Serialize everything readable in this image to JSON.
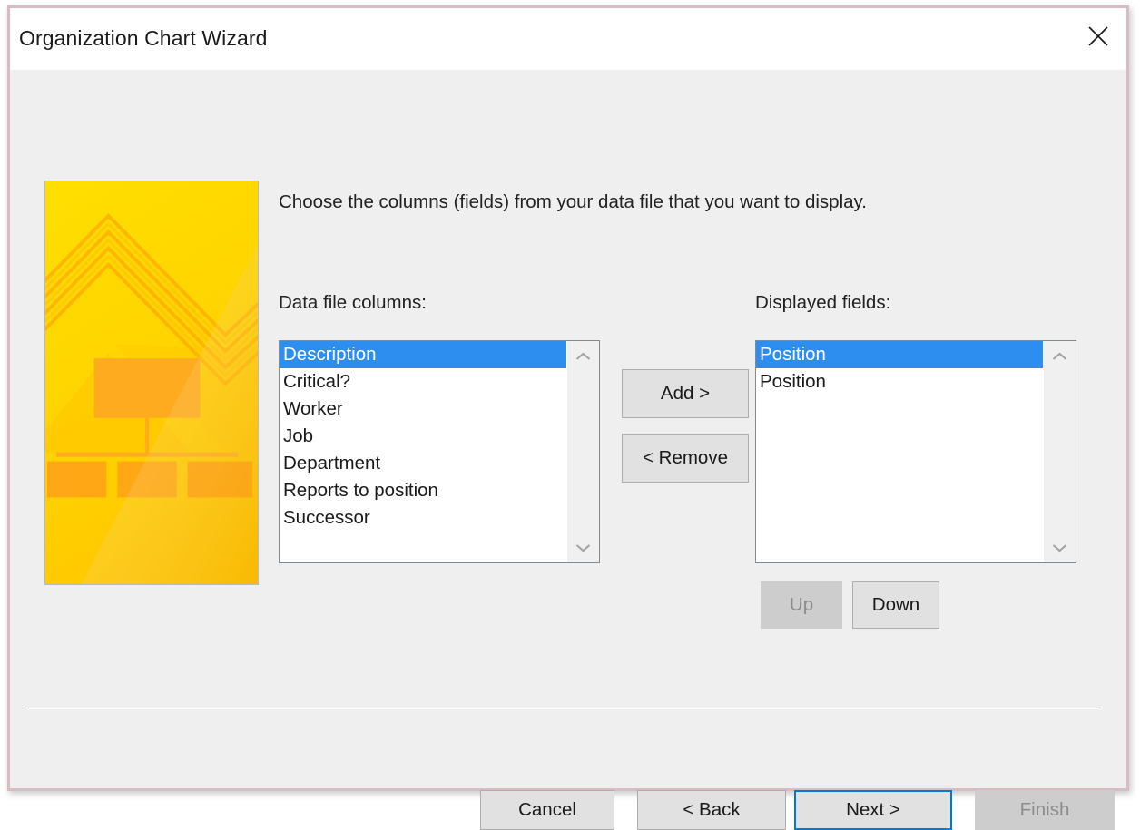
{
  "window": {
    "title": "Organization Chart Wizard",
    "close_icon": "close-icon",
    "border_color": "#d7bcc1",
    "titlebar_bg": "#ffffff",
    "body_bg": "#efefef"
  },
  "banner": {
    "alt": "organization-chart-wizard-banner",
    "base_color": "#ffdc00",
    "accent_color": "#ffb400",
    "shade_color": "#fcc200"
  },
  "main": {
    "instruction": "Choose the columns (fields) from your data file that you want to display."
  },
  "left_panel": {
    "label": "Data file columns:",
    "selection_color": "#2e8ef0",
    "items": [
      {
        "label": "Description",
        "selected": true
      },
      {
        "label": "Critical?",
        "selected": false
      },
      {
        "label": "Worker",
        "selected": false
      },
      {
        "label": "Job",
        "selected": false
      },
      {
        "label": "Department",
        "selected": false
      },
      {
        "label": "Reports to position",
        "selected": false
      },
      {
        "label": "Successor",
        "selected": false
      }
    ],
    "scroll_up_icon": "chevron-up-icon",
    "scroll_down_icon": "chevron-down-icon"
  },
  "right_panel": {
    "label": "Displayed fields:",
    "selection_color": "#2e8ef0",
    "items": [
      {
        "label": "Position",
        "selected": true
      },
      {
        "label": "Position",
        "selected": false
      }
    ],
    "scroll_up_icon": "chevron-up-icon",
    "scroll_down_icon": "chevron-down-icon"
  },
  "transfer_buttons": {
    "add": {
      "label": "Add >",
      "enabled": true
    },
    "remove": {
      "label": "< Remove",
      "enabled": true
    }
  },
  "reorder_buttons": {
    "up": {
      "label": "Up",
      "enabled": false
    },
    "down": {
      "label": "Down",
      "enabled": true
    }
  },
  "footer": {
    "cancel": {
      "label": "Cancel",
      "enabled": true,
      "default": false
    },
    "back": {
      "label": "< Back",
      "enabled": true,
      "default": false
    },
    "next": {
      "label": "Next >",
      "enabled": true,
      "default": true
    },
    "finish": {
      "label": "Finish",
      "enabled": false,
      "default": false
    },
    "focus_color": "#0078d7"
  }
}
